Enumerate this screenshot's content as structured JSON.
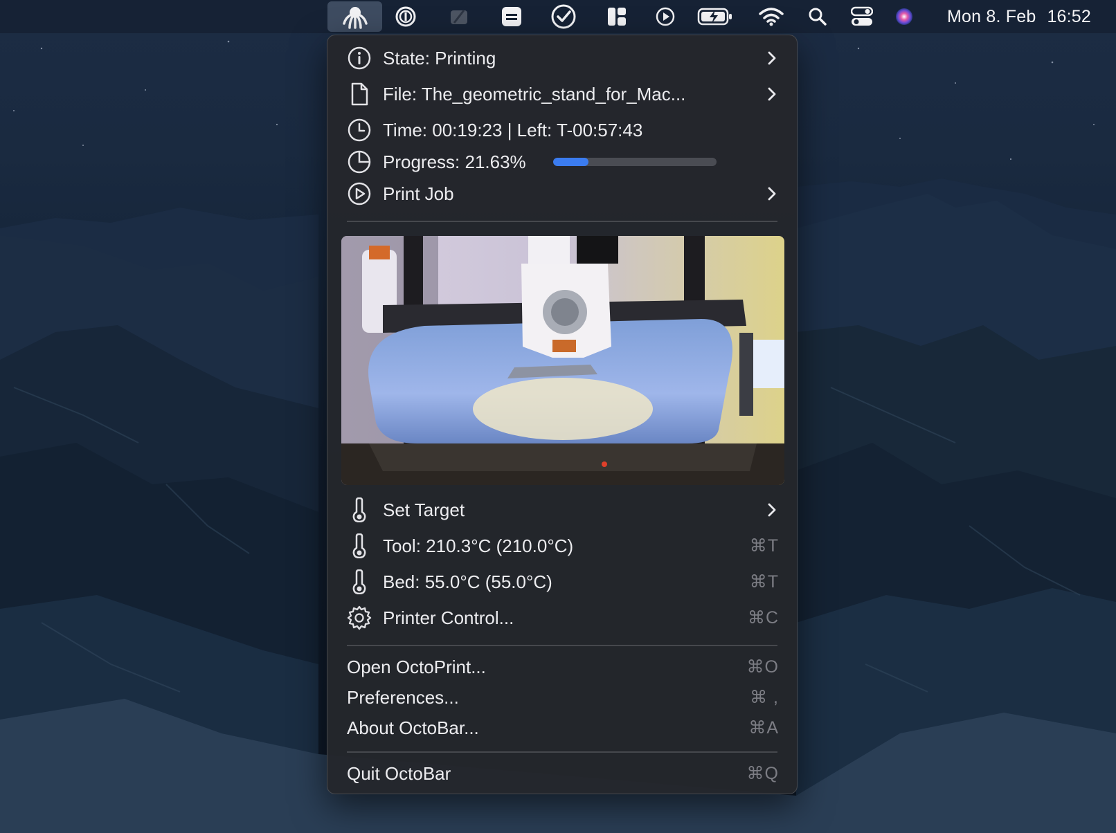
{
  "menubar": {
    "icons": [
      "octoprint-icon",
      "onepassword-icon",
      "app-icon-dim",
      "notes-icon",
      "tasks-check-icon",
      "window-layout-icon",
      "play-icon",
      "battery-charging-icon",
      "wifi-icon",
      "spotlight-search-icon",
      "control-center-icon",
      "siri-icon"
    ],
    "date": "Mon 8. Feb",
    "time": "16:52"
  },
  "menu": {
    "state_label": "State: Printing",
    "file_label": "File: The_geometric_stand_for_Mac...",
    "time_label": "Time: 00:19:23 | Left: T-00:57:43",
    "progress_label": "Progress: 21.63%",
    "progress_value": 21.63,
    "print_job_label": "Print Job",
    "set_target_label": "Set Target",
    "tool_label": "Tool: 210.3°C (210.0°C)",
    "tool_shortcut": "⌘T",
    "bed_label": "Bed: 55.0°C (55.0°C)",
    "bed_shortcut": "⌘T",
    "printer_control_label": "Printer Control...",
    "printer_control_shortcut": "⌘C",
    "open_octoprint_label": "Open OctoPrint...",
    "open_octoprint_shortcut": "⌘O",
    "preferences_label": "Preferences...",
    "preferences_shortcut": "⌘ ,",
    "about_label": "About OctoBar...",
    "about_shortcut": "⌘A",
    "quit_label": "Quit OctoBar",
    "quit_shortcut": "⌘Q"
  },
  "colors": {
    "accent": "#3b7cf0",
    "menu_bg": "#24262c",
    "menubar_bg": "#162234"
  }
}
